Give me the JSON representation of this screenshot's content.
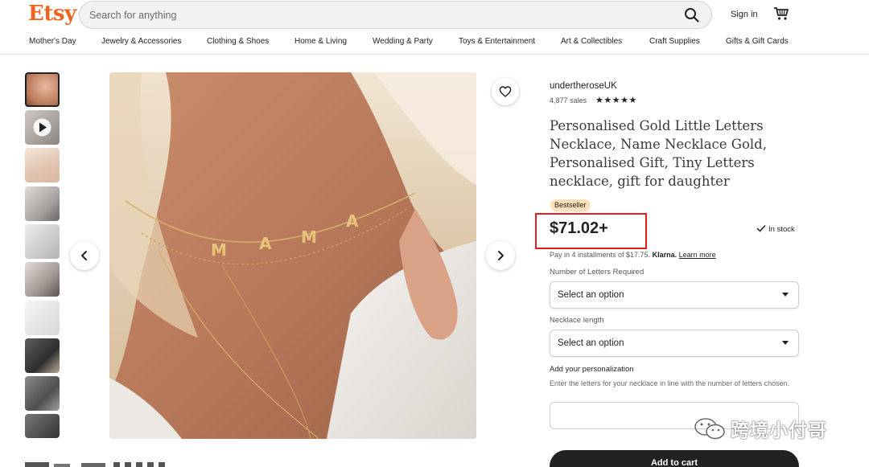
{
  "header": {
    "logo": "Etsy",
    "search_placeholder": "Search for anything",
    "signin_label": "Sign in"
  },
  "categories": [
    "Mother's Day",
    "Jewelry & Accessories",
    "Clothing & Shoes",
    "Home & Living",
    "Wedding & Party",
    "Toys & Entertainment",
    "Art & Collectibles",
    "Craft Supplies",
    "Gifts & Gift Cards"
  ],
  "product": {
    "shop_name": "undertheroseUK",
    "sales": "4,877 sales",
    "rating": 5,
    "title": "Personalised Gold Little Letters Necklace, Name Necklace Gold, Personalised Gift, Tiny Letters necklace, gift for daughter",
    "badge": "Bestseller",
    "price": "$71.02+",
    "stock": "In stock",
    "installments_text": "Pay in 4 installments of $17.75.",
    "klarna": "Klarna.",
    "learn_more": "Learn more",
    "image_text": "MAMA"
  },
  "options": {
    "letters_label": "Number of Letters Required",
    "letters_value": "Select an option",
    "length_label": "Necklace length",
    "length_value": "Select an option",
    "personalization_label": "Add your personalization",
    "personalization_hint": "Enter the letters for your necklace in line with the number of letters chosen."
  },
  "add_to_cart": "Add to cart",
  "watermark": "跨境小付哥",
  "colors": {
    "brand": "#F1641E",
    "highlight_box": "#e01e1e",
    "badge_bg": "#fddfba"
  }
}
